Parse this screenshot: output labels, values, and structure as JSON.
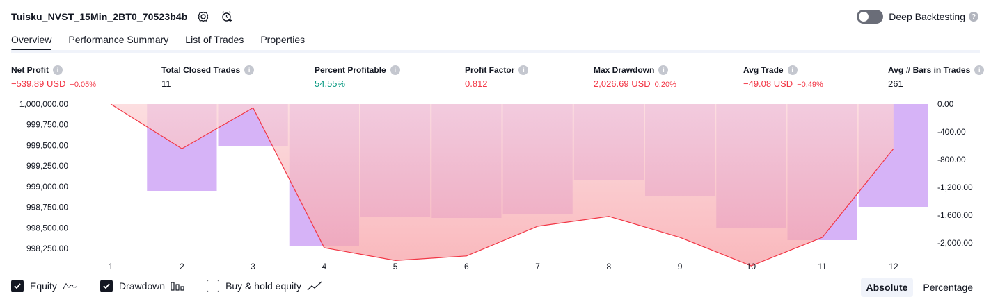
{
  "header": {
    "strategy_name": "Tuisku_NVST_15Min_2BT0_70523b4b",
    "deep_backtesting_label": "Deep Backtesting",
    "deep_backtesting_on": false
  },
  "tabs": [
    {
      "label": "Overview",
      "active": true
    },
    {
      "label": "Performance Summary",
      "active": false
    },
    {
      "label": "List of Trades",
      "active": false
    },
    {
      "label": "Properties",
      "active": false
    }
  ],
  "metrics": [
    {
      "label": "Net Profit",
      "value": "−539.89 USD",
      "sub": "−0.05%",
      "color": "#f23645"
    },
    {
      "label": "Total Closed Trades",
      "value": "11",
      "sub": "",
      "color": "#131722"
    },
    {
      "label": "Percent Profitable",
      "value": "54.55%",
      "sub": "",
      "color": "#089981"
    },
    {
      "label": "Profit Factor",
      "value": "0.812",
      "sub": "",
      "color": "#f23645"
    },
    {
      "label": "Max Drawdown",
      "value": "2,026.69 USD",
      "sub": "0.20%",
      "color": "#f23645"
    },
    {
      "label": "Avg Trade",
      "value": "−49.08 USD",
      "sub": "−0.49%",
      "color": "#f23645"
    },
    {
      "label": "Avg # Bars in Trades",
      "value": "261",
      "sub": "",
      "color": "#131722"
    }
  ],
  "chart_data": {
    "type": "bar",
    "x": [
      1,
      2,
      3,
      4,
      5,
      6,
      7,
      8,
      9,
      10,
      11,
      12
    ],
    "x_tick_labels": [
      "1",
      "2",
      "3",
      "4",
      "5",
      "6",
      "7",
      "8",
      "9",
      "10",
      "11",
      "12"
    ],
    "series": [
      {
        "name": "Equity",
        "type": "line",
        "axis": "left",
        "values": [
          1000000,
          999460,
          999955,
          998260,
          998105,
          998160,
          998520,
          998640,
          998385,
          998040,
          998385,
          999460
        ]
      },
      {
        "name": "Drawdown",
        "type": "bar",
        "axis": "right",
        "values": [
          0,
          -1250,
          -600,
          -2040,
          -1620,
          -1640,
          -1590,
          -1100,
          -1330,
          -1780,
          -1960,
          -1480
        ]
      }
    ],
    "left_axis": {
      "ylim": [
        998150,
        1000000
      ],
      "tick_labels": [
        "1,000,000.00",
        "999,750.00",
        "999,500.00",
        "999,250.00",
        "999,000.00",
        "998,750.00",
        "998,500.00",
        "998,250.00"
      ],
      "tick_values": [
        1000000,
        999750,
        999500,
        999250,
        999000,
        998750,
        998500,
        998250
      ]
    },
    "right_axis": {
      "ylim": [
        -2200,
        0
      ],
      "tick_labels": [
        "0.00",
        "-400.00",
        "-800.00",
        "-1,200.00",
        "-1,600.00",
        "-2,000.00"
      ],
      "tick_values": [
        0,
        -400,
        -800,
        -1200,
        -1600,
        -2000
      ]
    },
    "colors": {
      "equity_line": "#f23645",
      "drawdown_bar": "#d6b3f7",
      "equity_fill": "#f7a0a6"
    }
  },
  "legend": [
    {
      "label": "Equity",
      "checked": true,
      "icon": "equity-line-icon"
    },
    {
      "label": "Drawdown",
      "checked": true,
      "icon": "drawdown-bars-icon"
    },
    {
      "label": "Buy & hold equity",
      "checked": false,
      "icon": "buy-hold-line-icon"
    }
  ],
  "mode": {
    "absolute": "Absolute",
    "percentage": "Percentage",
    "selected": "Absolute"
  }
}
